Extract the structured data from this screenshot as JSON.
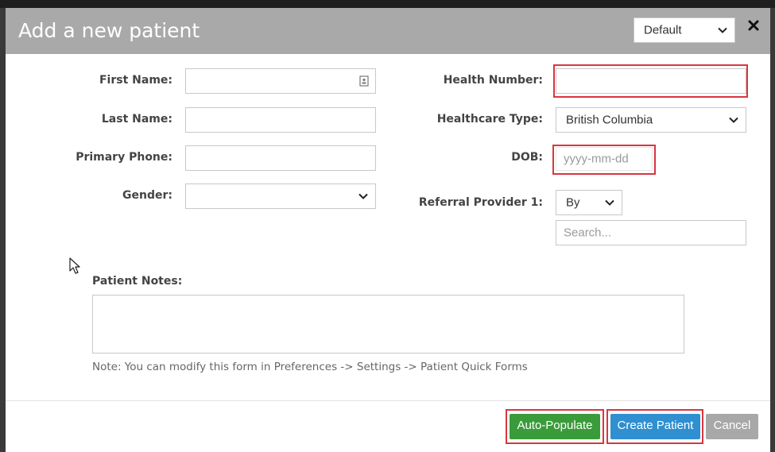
{
  "header": {
    "title": "Add a new patient",
    "template_select": "Default",
    "close_icon": "close-icon"
  },
  "left_fields": {
    "first_name_label": "First Name:",
    "first_name_value": "",
    "last_name_label": "Last Name:",
    "last_name_value": "",
    "primary_phone_label": "Primary Phone:",
    "primary_phone_value": "",
    "gender_label": "Gender:",
    "gender_value": ""
  },
  "right_fields": {
    "health_number_label": "Health Number:",
    "health_number_value": "",
    "healthcare_type_label": "Healthcare Type:",
    "healthcare_type_value": "British Columbia",
    "dob_label": "DOB:",
    "dob_placeholder": "yyyy-mm-dd",
    "referral_label": "Referral Provider 1:",
    "referral_by_value": "By",
    "referral_search_placeholder": "Search..."
  },
  "notes": {
    "label": "Patient Notes:",
    "value": "",
    "hint": "Note: You can modify this form in Preferences -> Settings -> Patient Quick Forms"
  },
  "footer": {
    "auto_populate_label": "Auto-Populate",
    "create_patient_label": "Create Patient",
    "cancel_label": "Cancel"
  },
  "colors": {
    "header_bg": "#a9a9a9",
    "highlight": "#d9363e",
    "auto_populate": "#3a9b3a",
    "create_patient": "#2f8fd0",
    "cancel": "#a8a8a8"
  }
}
